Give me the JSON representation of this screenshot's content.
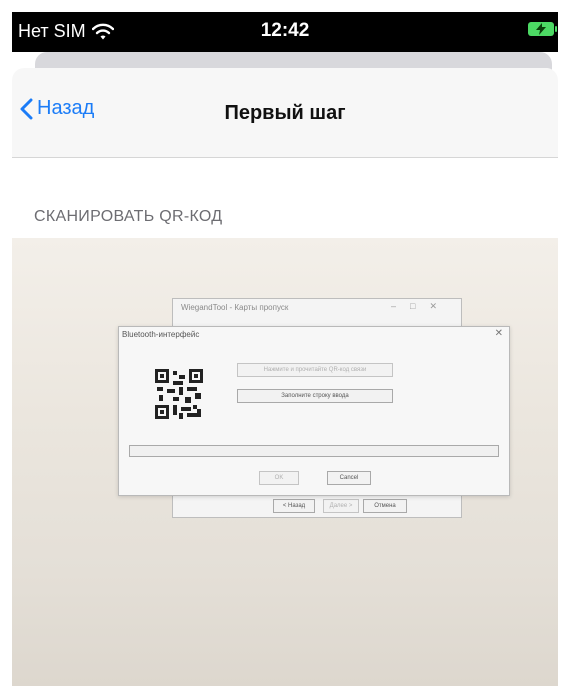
{
  "status_bar": {
    "carrier": "Нет SIM",
    "time": "12:42"
  },
  "nav": {
    "back_label": "Назад",
    "title": "Первый шаг"
  },
  "section": {
    "header": "СКАНИРОВАТЬ QR-КОД"
  },
  "camera_preview": {
    "back_window_title": "WiegandTool - Карты пропуск",
    "dialog_title": "Bluetooth-интерфейс",
    "dialog_button_1": "Нажмите и прочитайте QR-код связи",
    "dialog_button_2": "Заполните строку ввода",
    "ok_label": "OK",
    "cancel_label": "Cancel",
    "back_button": "< Назад",
    "next_button": "Далее >",
    "cancel_ru": "Отмена"
  },
  "colors": {
    "accent": "#1b7cf7",
    "battery": "#4cd964"
  },
  "icons": [
    "wifi-icon",
    "battery-charging-icon",
    "chevron-left-icon",
    "qr-code-icon",
    "close-icon"
  ]
}
